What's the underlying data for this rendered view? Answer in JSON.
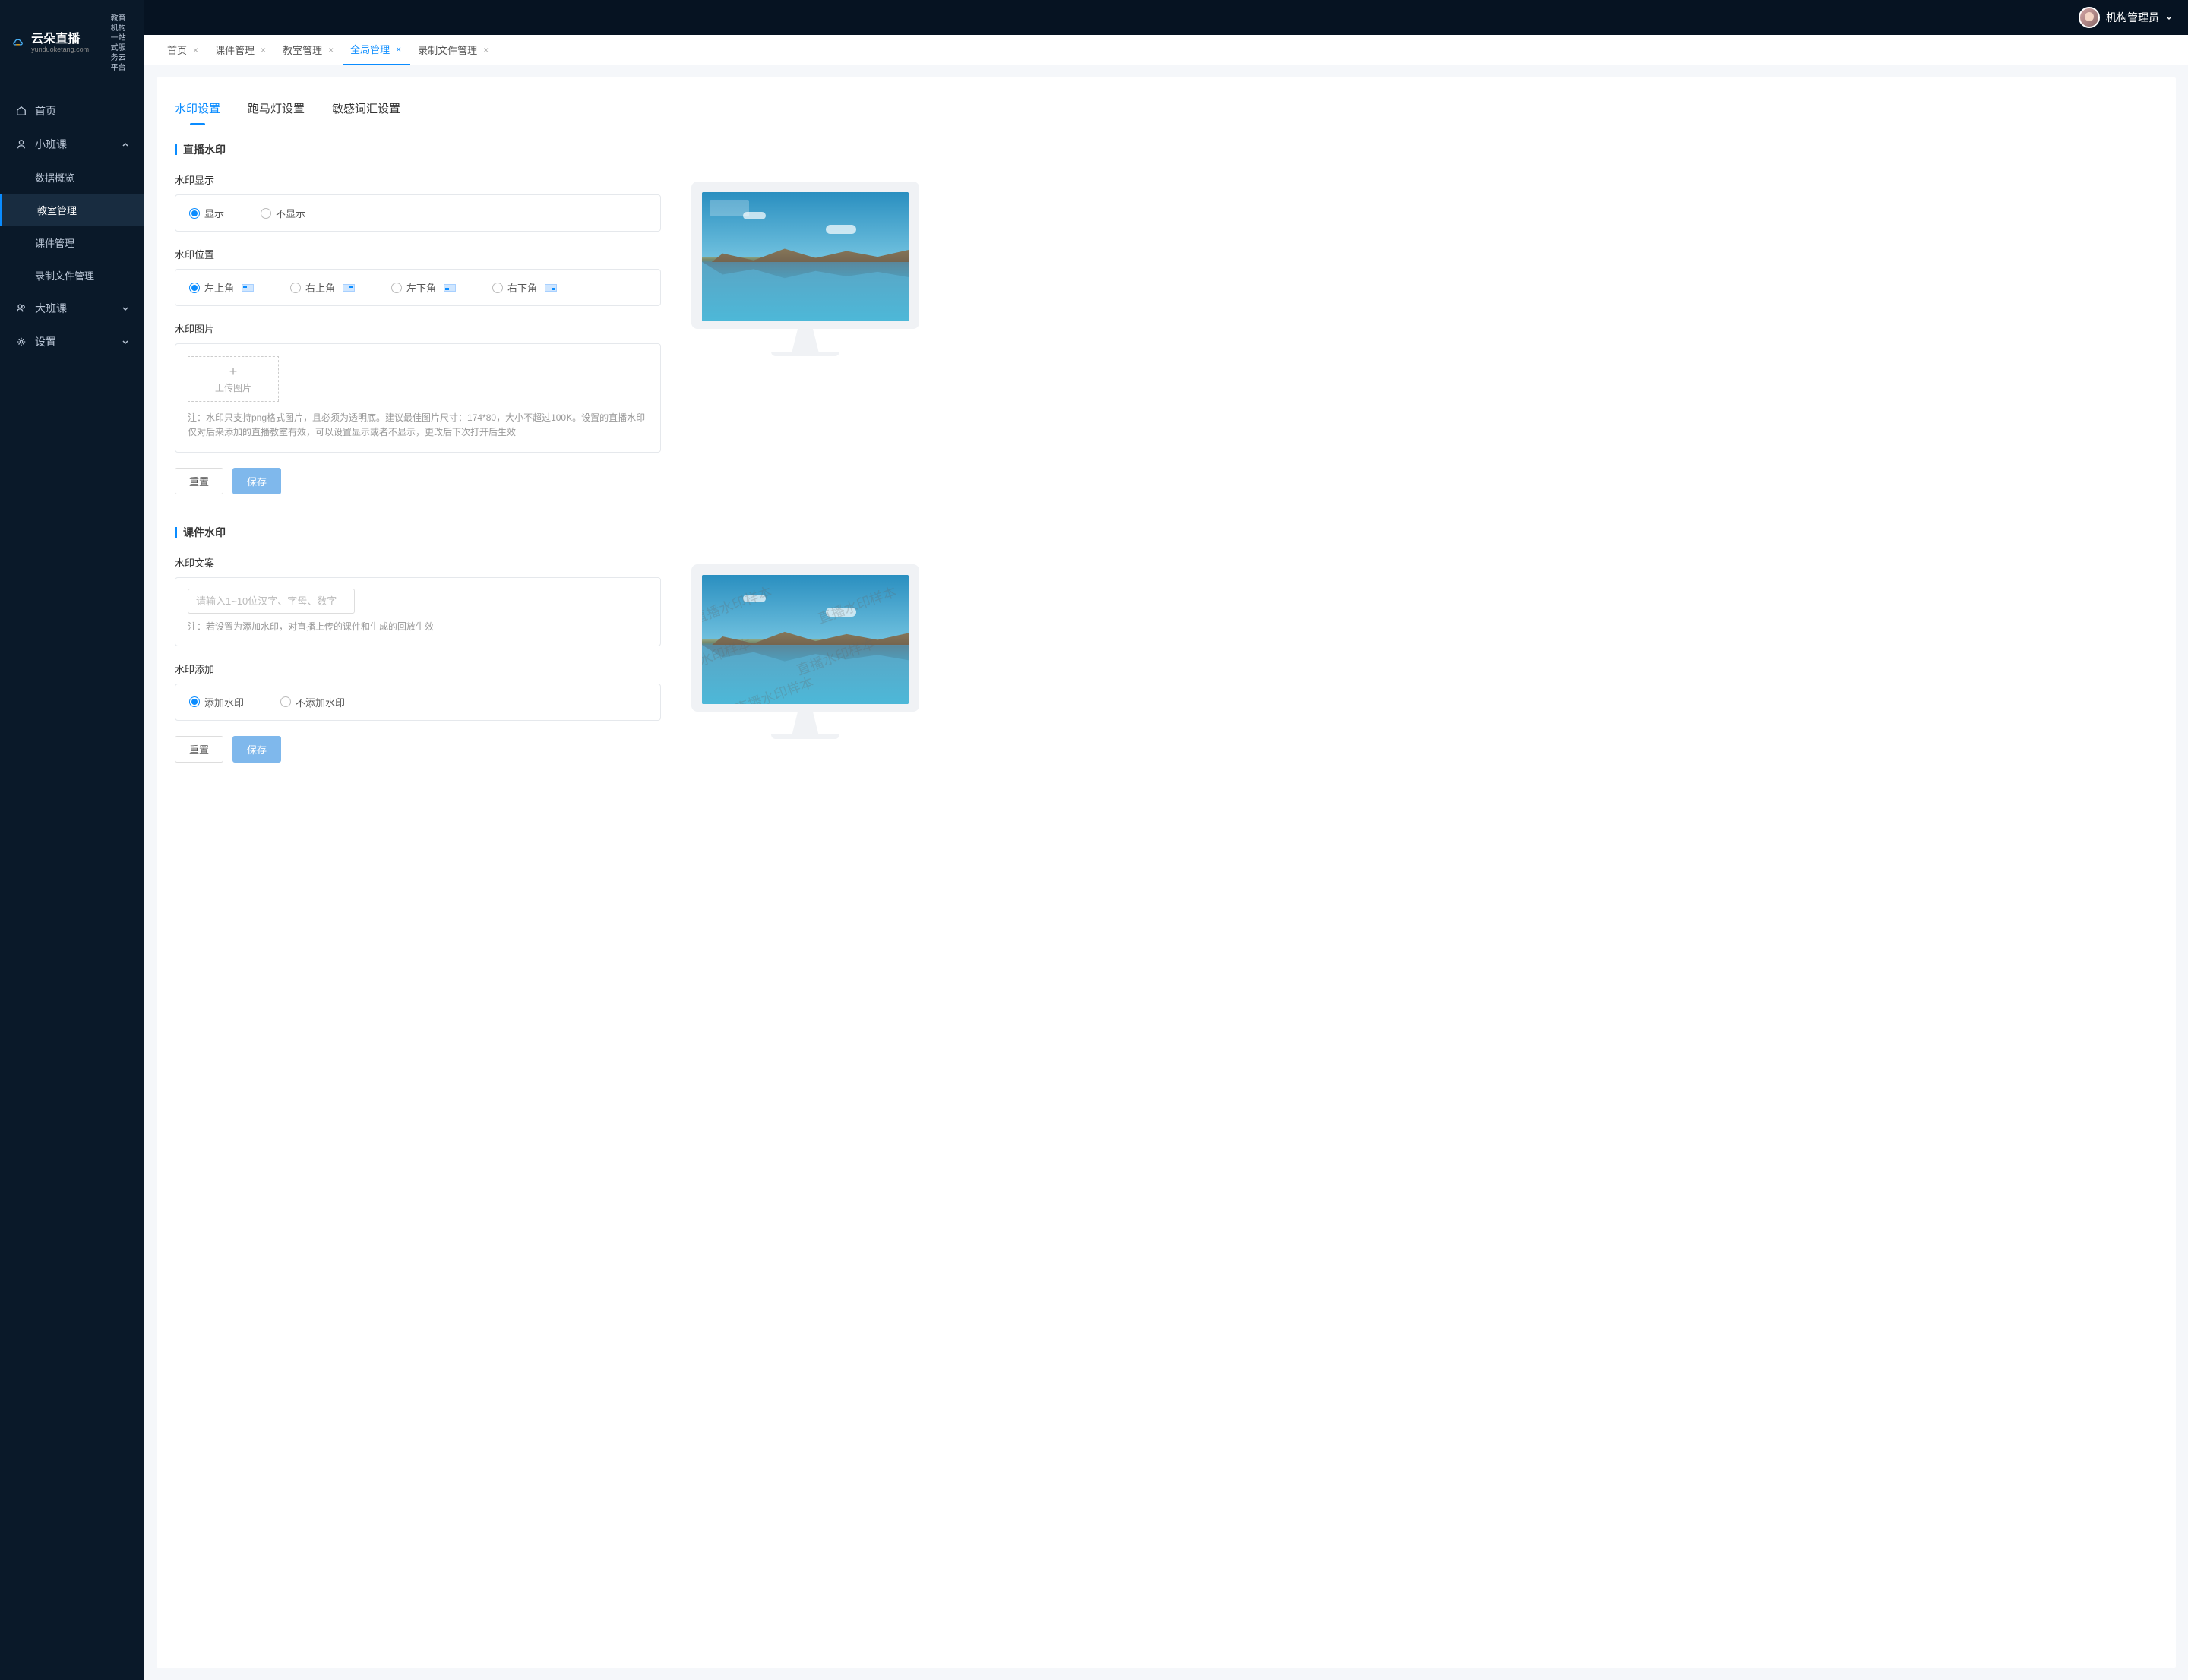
{
  "logo": {
    "main": "云朵直播",
    "sub": "yunduoketang.com",
    "tagline1": "教育机构一站",
    "tagline2": "式服务云平台"
  },
  "header": {
    "user": "机构管理员"
  },
  "sidebar": {
    "items": [
      {
        "label": "首页"
      },
      {
        "label": "小班课"
      },
      {
        "label": "数据概览"
      },
      {
        "label": "教室管理"
      },
      {
        "label": "课件管理"
      },
      {
        "label": "录制文件管理"
      },
      {
        "label": "大班课"
      },
      {
        "label": "设置"
      }
    ]
  },
  "tabs": [
    {
      "label": "首页"
    },
    {
      "label": "课件管理"
    },
    {
      "label": "教室管理"
    },
    {
      "label": "全局管理"
    },
    {
      "label": "录制文件管理"
    }
  ],
  "content_tabs": [
    {
      "label": "水印设置"
    },
    {
      "label": "跑马灯设置"
    },
    {
      "label": "敏感词汇设置"
    }
  ],
  "live": {
    "title": "直播水印",
    "display_label": "水印显示",
    "opts_display": [
      "显示",
      "不显示"
    ],
    "pos_label": "水印位置",
    "opts_pos": [
      "左上角",
      "右上角",
      "左下角",
      "右下角"
    ],
    "img_label": "水印图片",
    "upload_text": "上传图片",
    "hint": "注：水印只支持png格式图片，且必须为透明底。建议最佳图片尺寸：174*80，大小不超过100K。设置的直播水印仅对后来添加的直播教室有效，可以设置显示或者不显示，更改后下次打开后生效"
  },
  "course": {
    "title": "课件水印",
    "text_label": "水印文案",
    "placeholder": "请输入1~10位汉字、字母、数字",
    "hint": "注：若设置为添加水印，对直播上传的课件和生成的回放生效",
    "add_label": "水印添加",
    "opts_add": [
      "添加水印",
      "不添加水印"
    ],
    "sample_text": "直播水印样本"
  },
  "buttons": {
    "reset": "重置",
    "save": "保存"
  }
}
